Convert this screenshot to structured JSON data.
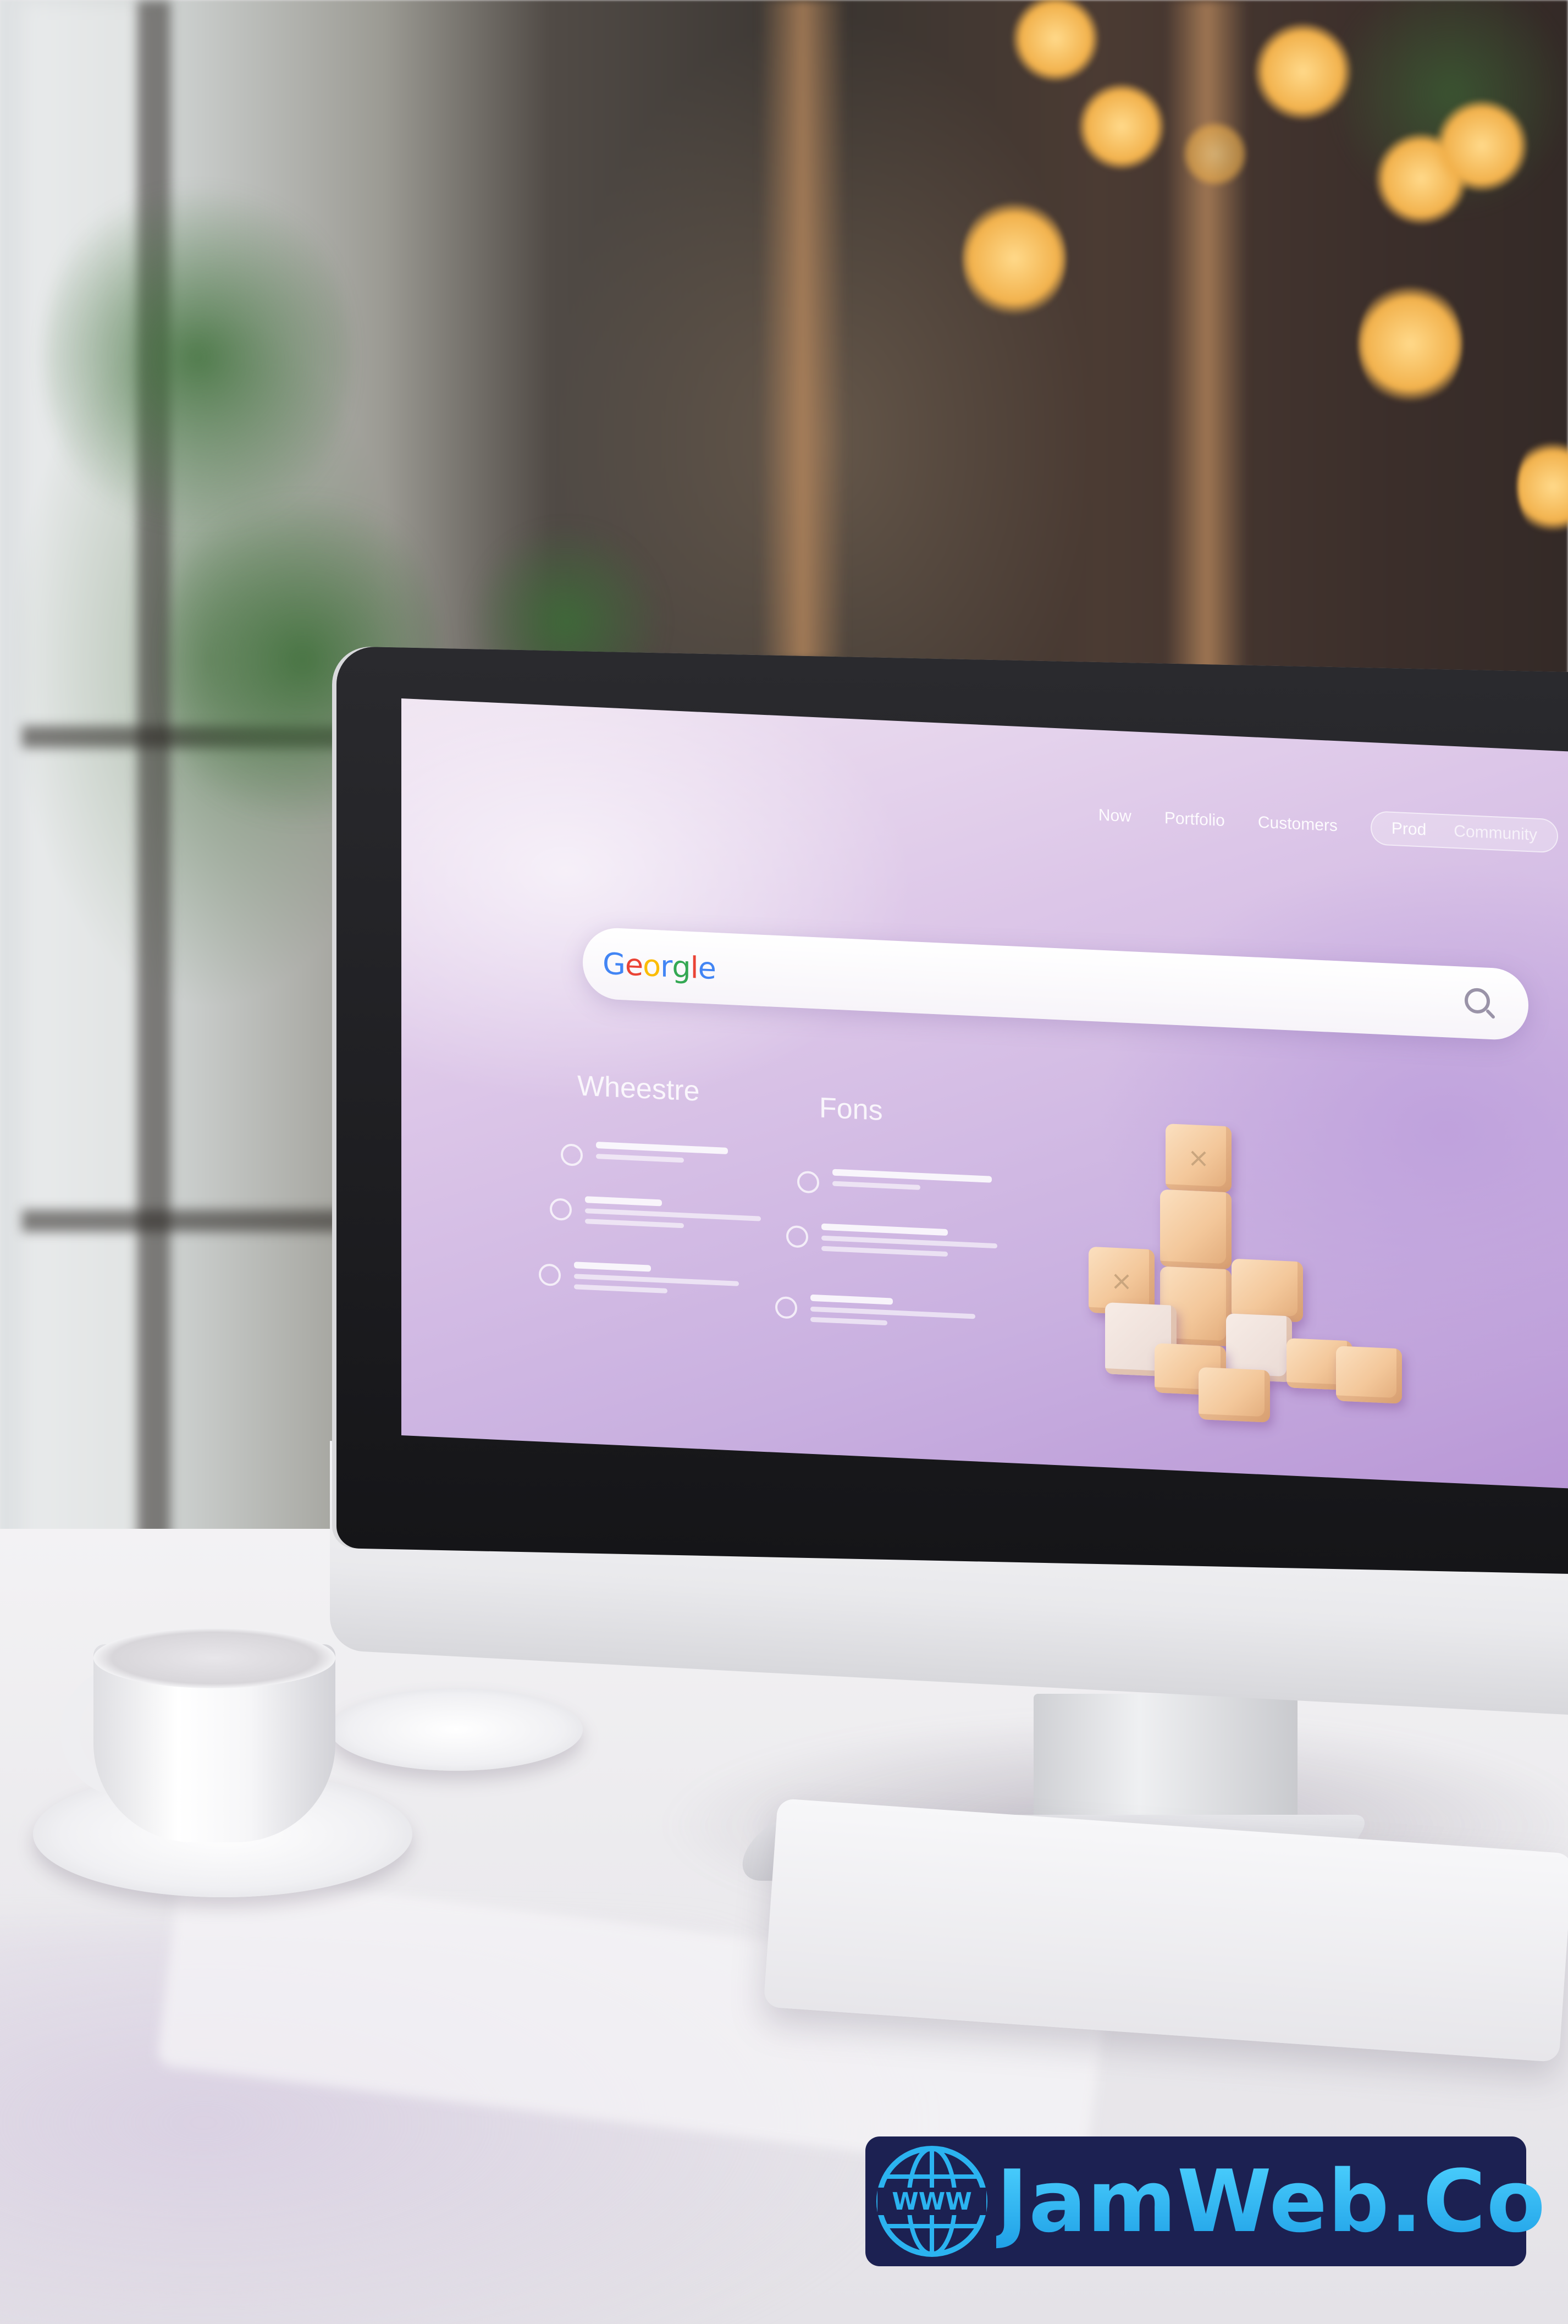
{
  "screen": {
    "nav": {
      "items": [
        "Now",
        "Portfolio",
        "Customers"
      ],
      "pill_items": [
        "Prod",
        "Community"
      ]
    },
    "search": {
      "logo_text": "Georgle",
      "logo_colors": [
        "#4285F4",
        "#EA4335",
        "#FBBC05",
        "#4285F4",
        "#34A853",
        "#EA4335",
        "#4285F4"
      ]
    },
    "columns": [
      {
        "title": "Wheestre"
      },
      {
        "title": "Fons"
      }
    ]
  },
  "brand": {
    "globe_text": "WWW",
    "name": "JamWeb.Co",
    "badge_color": "#1c2152",
    "text_color": "#25b6ef"
  }
}
